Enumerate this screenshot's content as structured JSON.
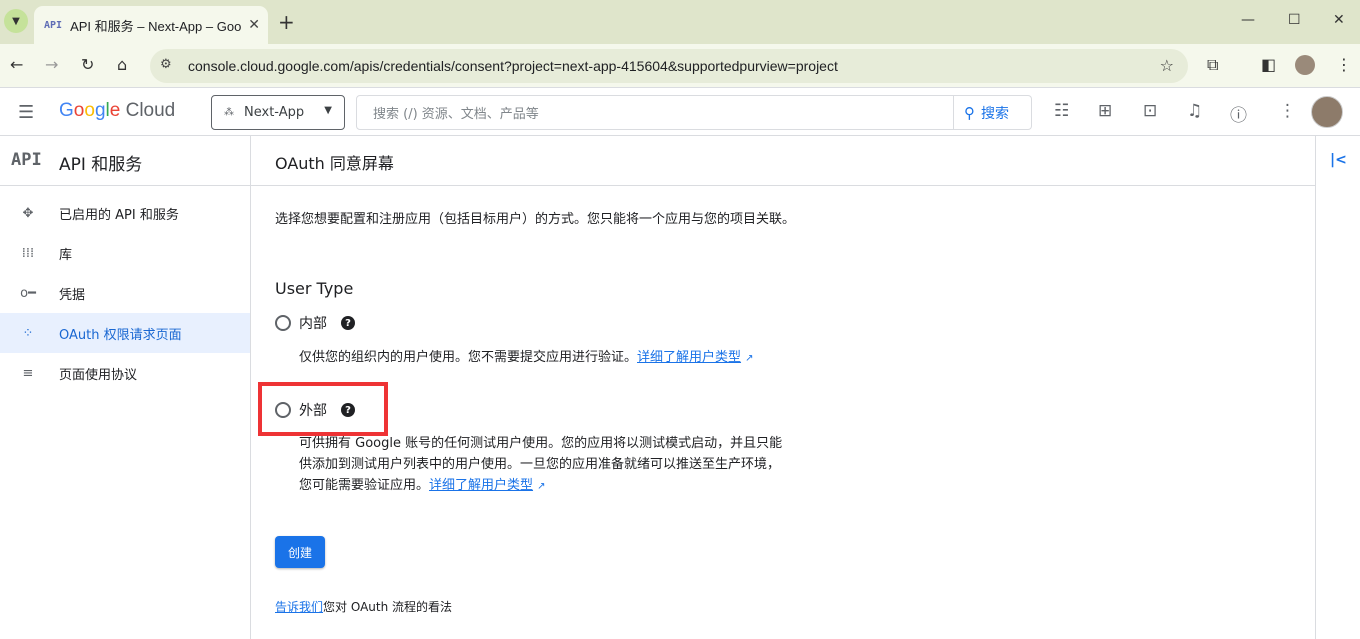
{
  "browser": {
    "tab_title": "API 和服务 – Next-App – Goo",
    "tab_favicon": "API",
    "url": "console.cloud.google.com/apis/credentials/consent?project=next-app-415604&supportedpurview=project"
  },
  "header": {
    "logo_parts": [
      "G",
      "o",
      "o",
      "g",
      "l",
      "e",
      " Cloud"
    ],
    "project": "Next-App",
    "search_placeholder": "搜索 (/) 资源、文档、产品等",
    "search_button": "搜索"
  },
  "sidebar": {
    "icon": "API",
    "title": "API 和服务",
    "items": [
      {
        "label": "已启用的 API 和服务",
        "icon": "api-icon",
        "glyph": "✥",
        "active": false
      },
      {
        "label": "库",
        "icon": "library-icon",
        "glyph": "⁞⁞⁞",
        "active": false
      },
      {
        "label": "凭据",
        "icon": "key-icon",
        "glyph": "o━",
        "active": false
      },
      {
        "label": "OAuth 权限请求页面",
        "icon": "consent-icon",
        "glyph": "⁘",
        "active": true
      },
      {
        "label": "页面使用协议",
        "icon": "settings-list-icon",
        "glyph": "≡",
        "active": false
      }
    ]
  },
  "main": {
    "title": "OAuth 同意屏幕",
    "intro": "选择您想要配置和注册应用（包括目标用户）的方式。您只能将一个应用与您的项目关联。",
    "user_type_heading": "User Type",
    "internal": {
      "label": "内部",
      "desc": "仅供您的组织内的用户使用。您不需要提交应用进行验证。",
      "link": "详细了解用户类型"
    },
    "external": {
      "label": "外部",
      "desc": "可供拥有 Google 账号的任何测试用户使用。您的应用将以测试模式启动，并且只能供添加到测试用户列表中的用户使用。一旦您的应用准备就绪可以推送至生产环境，您可能需要验证应用。",
      "link": "详细了解用户类型"
    },
    "create_button": "创建",
    "footer_link": "告诉我们",
    "footer_text": "您对 OAuth 流程的看法"
  },
  "colors": {
    "accent": "#1a73e8",
    "highlight": "#ee3335",
    "active_bg": "#e8f0fe"
  }
}
